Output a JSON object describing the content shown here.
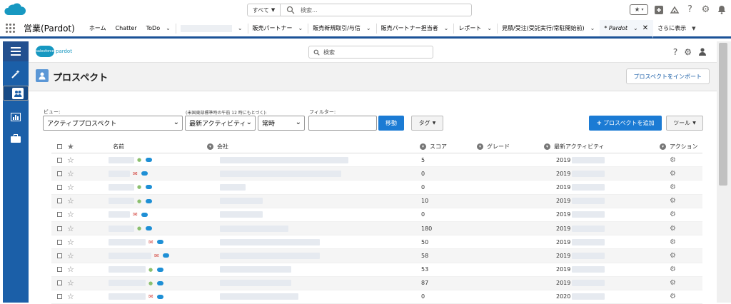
{
  "global_header": {
    "search_scope": "すべて",
    "search_placeholder": "検索..."
  },
  "app_nav": {
    "app_name": "営業(Pardot)",
    "items": [
      {
        "label": "ホーム",
        "chevron": false
      },
      {
        "label": "Chatter",
        "chevron": false
      },
      {
        "label": "ToDo",
        "chevron": true
      },
      {
        "label": "",
        "chevron": true,
        "blurred": true
      },
      {
        "label": "販売パートナー",
        "chevron": true
      },
      {
        "label": "販売新規取引/与信",
        "chevron": true
      },
      {
        "label": "販売パートナー担当者",
        "chevron": true
      },
      {
        "label": "レポート",
        "chevron": true
      },
      {
        "label": "見積/受注(受託実行/常駐開始前)",
        "chevron": true
      }
    ],
    "active_tab": "* Pardot",
    "more_label": "さらに表示"
  },
  "pardot": {
    "logo_badge": "salesforce",
    "logo_word": "pardot",
    "search_placeholder": "検索",
    "page_title": "プロスペクト",
    "import_button": "プロスペクトをインポート"
  },
  "filters": {
    "view_label": "ビュー:",
    "view_value": "アクティブプロスペクト",
    "timezone_note": "(米国東部標準時の午前 12 時にもとづく):",
    "activity_value": "最新アクティビティ",
    "period_value": "常時",
    "filter_label": "フィルター:",
    "filter_value": "",
    "go_button": "移動",
    "tag_button": "タグ",
    "add_button": "プロスペクトを追加",
    "tools_button": "ツール"
  },
  "table": {
    "columns": [
      "名前",
      "会社",
      "スコア",
      "グレード",
      "最新アクティビティ",
      "アクション"
    ],
    "rows": [
      {
        "score": "5",
        "activity": "2019",
        "mail": false,
        "user": true,
        "name_w": 36,
        "company_w": 180
      },
      {
        "score": "0",
        "activity": "2019",
        "mail": true,
        "user": false,
        "name_w": 30,
        "company_w": 170
      },
      {
        "score": "0",
        "activity": "2019",
        "mail": false,
        "user": true,
        "name_w": 36,
        "company_w": 36
      },
      {
        "score": "10",
        "activity": "2019",
        "mail": false,
        "user": true,
        "name_w": 36,
        "company_w": 60
      },
      {
        "score": "0",
        "activity": "2019",
        "mail": true,
        "user": false,
        "name_w": 30,
        "company_w": 60
      },
      {
        "score": "180",
        "activity": "2019",
        "mail": false,
        "user": true,
        "name_w": 36,
        "company_w": 96
      },
      {
        "score": "50",
        "activity": "2019",
        "mail": true,
        "user": false,
        "name_w": 52,
        "company_w": 140
      },
      {
        "score": "58",
        "activity": "2019",
        "mail": true,
        "user": false,
        "name_w": 60,
        "company_w": 140
      },
      {
        "score": "53",
        "activity": "2019",
        "mail": false,
        "user": true,
        "name_w": 52,
        "company_w": 100
      },
      {
        "score": "87",
        "activity": "2019",
        "mail": false,
        "user": true,
        "name_w": 52,
        "company_w": 100
      },
      {
        "score": "0",
        "activity": "2020",
        "mail": true,
        "user": false,
        "name_w": 52,
        "company_w": 110
      }
    ]
  },
  "colors": {
    "brand": "#1b5297",
    "sidebar": "#1b5fa8",
    "button_blue": "#1b7bd4"
  }
}
